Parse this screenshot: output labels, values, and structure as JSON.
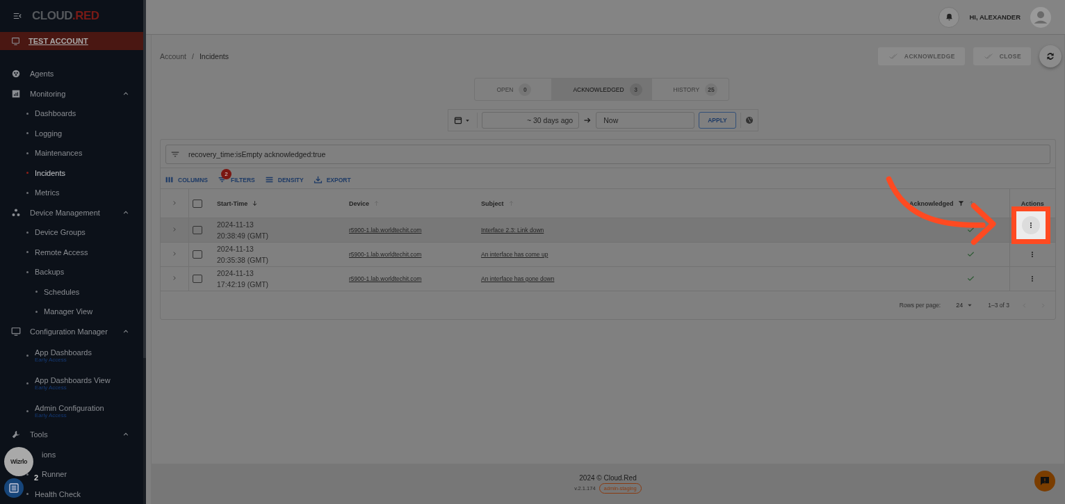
{
  "logo": {
    "main": "CLOUD",
    "accent": ".RED"
  },
  "account": {
    "label": "TEST ACCOUNT"
  },
  "sidebar": {
    "items": [
      {
        "label": "Agents"
      },
      {
        "label": "Monitoring",
        "expanded": true,
        "children": [
          {
            "label": "Dashboards",
            "selected": false
          },
          {
            "label": "Logging",
            "selected": false
          },
          {
            "label": "Maintenances",
            "selected": false
          },
          {
            "label": "Incidents",
            "selected": true
          },
          {
            "label": "Metrics",
            "selected": false
          }
        ]
      },
      {
        "label": "Device Management",
        "expanded": true,
        "children": [
          {
            "label": "Device Groups",
            "selected": false
          },
          {
            "label": "Remote Access",
            "selected": false
          },
          {
            "label": "Backups",
            "selected": false,
            "children": [
              {
                "label": "Schedules",
                "selected": false
              },
              {
                "label": "Manager View",
                "selected": false
              }
            ]
          }
        ]
      },
      {
        "label": "Configuration Manager",
        "expanded": true,
        "children": [
          {
            "label": "App Dashboards",
            "tag": "Early Access",
            "selected": false
          },
          {
            "label": "App Dashboards View",
            "tag": "Early Access",
            "selected": false
          },
          {
            "label": "Admin Configuration",
            "tag": "Early Access",
            "selected": false
          }
        ]
      },
      {
        "label": "Tools",
        "expanded": true,
        "children": [
          {
            "label": "ions",
            "kind": "clipped",
            "selected": false
          },
          {
            "label": "Runner",
            "kind": "clipped",
            "selected": false
          },
          {
            "label": "Health Check",
            "selected": false
          }
        ]
      }
    ]
  },
  "floating": {
    "recorder_label": "Wizrlo",
    "badge": "2"
  },
  "header": {
    "greeting": "HI, ALEXANDER"
  },
  "breadcrumb": {
    "separator": "/",
    "items": [
      "Account",
      "Incidents"
    ]
  },
  "actions": [
    {
      "label": "ACKNOWLEDGE",
      "disabled": true
    },
    {
      "label": "CLOSE",
      "disabled": true
    }
  ],
  "tabs": [
    {
      "label": "OPEN",
      "count": "0",
      "selected": false
    },
    {
      "label": "ACKNOWLEDGED",
      "count": "3",
      "selected": true
    },
    {
      "label": "HISTORY",
      "count": "25",
      "selected": false
    }
  ],
  "date_range": {
    "from": "~ 30 days ago",
    "to": "Now",
    "apply": "APPLY"
  },
  "filter": {
    "value": "recovery_time:isEmpty acknowledged:true"
  },
  "toolbar": [
    {
      "label": "COLUMNS"
    },
    {
      "label": "FILTERS",
      "badge": "2"
    },
    {
      "label": "DENSITY"
    },
    {
      "label": "EXPORT"
    }
  ],
  "table": {
    "select_all": false,
    "columns": [
      {
        "label": "Start-Time",
        "sorted": true
      },
      {
        "label": "Device",
        "sorted": false
      },
      {
        "label": "Subject",
        "sorted": false
      },
      {
        "label": "Acknowledged",
        "sorted": false,
        "filtered": true
      },
      {
        "label": "Actions"
      }
    ],
    "rows": [
      {
        "date": "2024-11-13",
        "time": "20:38:49 (GMT)",
        "device": "r5900-1.lab.worldtechit.com",
        "subject": "Interface 2.3: Link down",
        "acknowledged": true,
        "checked": false,
        "highlighted": true
      },
      {
        "date": "2024-11-13",
        "time": "20:35:38 (GMT)",
        "device": "r5900-1.lab.worldtechit.com",
        "subject": "An interface has come up",
        "acknowledged": true,
        "checked": false,
        "highlighted": false
      },
      {
        "date": "2024-11-13",
        "time": "17:42:19 (GMT)",
        "device": "r5900-1.lab.worldtechit.com",
        "subject": "An interface has gone down",
        "acknowledged": true,
        "checked": false,
        "highlighted": false
      }
    ]
  },
  "pagination": {
    "rows_label": "Rows per page:",
    "rows_value": "24",
    "range": "1–3 of 3"
  },
  "footer": {
    "copyright": "2024  © Cloud.Red",
    "version": "v.2.1.174",
    "env": "admin-staging"
  }
}
